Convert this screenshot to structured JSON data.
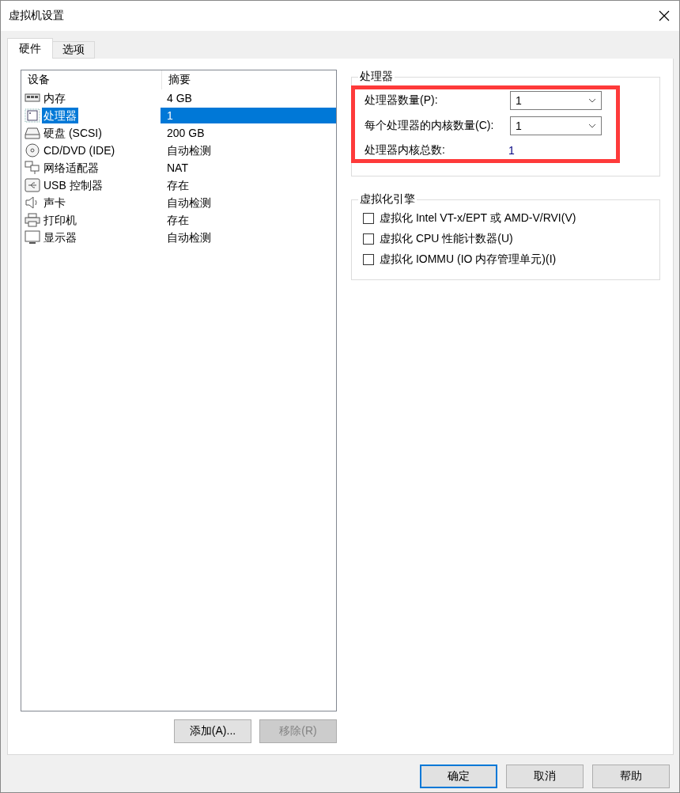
{
  "window": {
    "title": "虚拟机设置"
  },
  "tabs": [
    {
      "label": "硬件",
      "selected": true
    },
    {
      "label": "选项",
      "selected": false
    }
  ],
  "device_list": {
    "columns": [
      "设备",
      "摘要"
    ],
    "rows": [
      {
        "kind": "memory",
        "device": "内存",
        "summary": "4 GB",
        "selected": false
      },
      {
        "kind": "cpu",
        "device": "处理器",
        "summary": "1",
        "selected": true
      },
      {
        "kind": "disk",
        "device": "硬盘 (SCSI)",
        "summary": "200 GB",
        "selected": false
      },
      {
        "kind": "optical",
        "device": "CD/DVD (IDE)",
        "summary": "自动检测",
        "selected": false
      },
      {
        "kind": "network",
        "device": "网络适配器",
        "summary": "NAT",
        "selected": false
      },
      {
        "kind": "usb",
        "device": "USB 控制器",
        "summary": "存在",
        "selected": false
      },
      {
        "kind": "sound",
        "device": "声卡",
        "summary": "自动检测",
        "selected": false
      },
      {
        "kind": "printer",
        "device": "打印机",
        "summary": "存在",
        "selected": false
      },
      {
        "kind": "display",
        "device": "显示器",
        "summary": "自动检测",
        "selected": false
      }
    ]
  },
  "list_buttons": [
    {
      "label": "添加(A)...",
      "disabled": false
    },
    {
      "label": "移除(R)",
      "disabled": true
    }
  ],
  "processor": {
    "title": "处理器",
    "highlighted": true,
    "fields": [
      {
        "label": "处理器数量(P):",
        "value": "1"
      },
      {
        "label": "每个处理器的内核数量(C):",
        "value": "1"
      }
    ],
    "total_label": "处理器内核总数:",
    "total_value": "1"
  },
  "virtualization": {
    "title": "虚拟化引擎",
    "options": [
      {
        "label": "虚拟化 Intel VT-x/EPT 或 AMD-V/RVI(V)",
        "checked": false
      },
      {
        "label": "虚拟化 CPU 性能计数器(U)",
        "checked": false
      },
      {
        "label": "虚拟化 IOMMU (IO 内存管理单元)(I)",
        "checked": false
      }
    ]
  },
  "dialog_buttons": [
    {
      "label": "确定",
      "default": true
    },
    {
      "label": "取消",
      "default": false
    },
    {
      "label": "帮助",
      "default": false
    }
  ]
}
